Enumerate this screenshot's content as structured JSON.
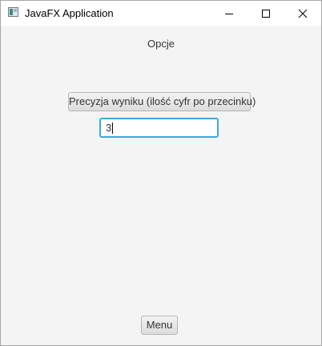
{
  "window": {
    "title": "JavaFX Application"
  },
  "options": {
    "heading": "Opcje",
    "precision_button": "Precyzja wyniku (ilość cyfr po przecinku)",
    "precision_value": "3"
  },
  "footer": {
    "menu_button": "Menu"
  },
  "colors": {
    "focus_ring": "#3fa9d9",
    "background": "#f4f4f4"
  }
}
